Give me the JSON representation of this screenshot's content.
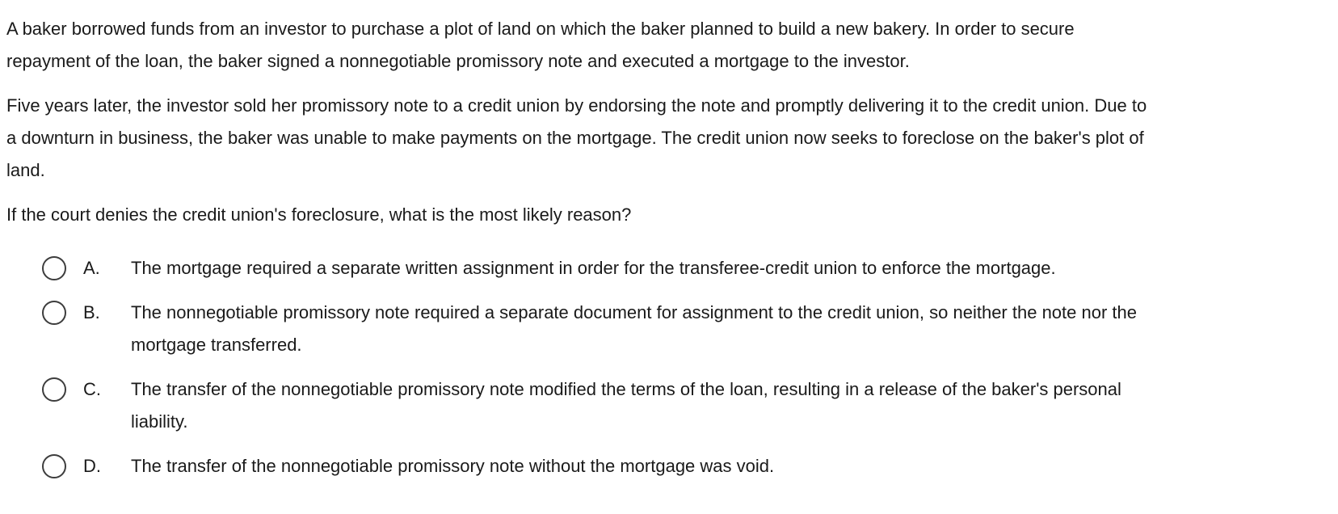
{
  "question": {
    "paragraph1": [
      "A baker borrowed funds from an investor to purchase a plot of land on which the baker planned to build a new bakery.  In order to secure",
      "repayment of the loan, the baker signed a nonnegotiable promissory note and executed a mortgage to the investor."
    ],
    "paragraph2": [
      "Five years later, the investor sold her promissory note to a credit union by endorsing the note and promptly delivering it to the credit union.  Due to",
      "a downturn in business, the baker was unable to make payments on the mortgage.  The credit union now seeks to foreclose on the baker's plot of",
      "land."
    ],
    "prompt": "If the court denies the credit union's foreclosure, what is the most likely reason?"
  },
  "options": [
    {
      "letter": "A.",
      "lines": [
        "The mortgage required a separate written assignment in order for the transferee-credit union to enforce the mortgage."
      ],
      "selected": false
    },
    {
      "letter": "B.",
      "lines": [
        "The nonnegotiable promissory note required a separate document for assignment to the credit union, so neither the note nor the",
        "mortgage transferred."
      ],
      "selected": false
    },
    {
      "letter": "C.",
      "lines": [
        "The transfer of the nonnegotiable promissory note modified the terms of the loan, resulting in a release of the baker's personal",
        "liability."
      ],
      "selected": false
    },
    {
      "letter": "D.",
      "lines": [
        "The transfer of the nonnegotiable promissory note without the mortgage was void."
      ],
      "selected": false
    }
  ]
}
